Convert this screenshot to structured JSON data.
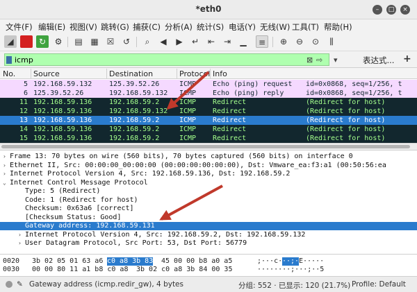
{
  "window": {
    "title": "*eth0",
    "min_icon": "minimize-icon",
    "max_icon": "maximize-icon",
    "close_icon": "close-icon"
  },
  "menu": [
    "文件(F)",
    "编辑(E)",
    "视图(V)",
    "跳转(G)",
    "捕获(C)",
    "分析(A)",
    "统计(S)",
    "电话(Y)",
    "无线(W)",
    "工具(T)",
    "帮助(H)"
  ],
  "filter": {
    "value": "icmp",
    "expression_label": "表达式...",
    "add_label": "+"
  },
  "packet_list": {
    "columns": [
      "No.",
      "Source",
      "Destination",
      "Protocol",
      "Info"
    ],
    "rows": [
      {
        "no": "5",
        "src": "192.168.59.132",
        "dst": "125.39.52.26",
        "proto": "ICMP",
        "info": "Echo (ping) request",
        "extra": "id=0x0868, seq=1/256, t",
        "style": "echo"
      },
      {
        "no": "6",
        "src": "125.39.52.26",
        "dst": "192.168.59.132",
        "proto": "ICMP",
        "info": "Echo (ping) reply",
        "extra": "id=0x0868, seq=1/256, t",
        "style": "echo"
      },
      {
        "no": "11",
        "src": "192.168.59.136",
        "dst": "192.168.59.2",
        "proto": "ICMP",
        "info": "Redirect",
        "extra": "(Redirect for host)",
        "style": "redir"
      },
      {
        "no": "12",
        "src": "192.168.59.136",
        "dst": "192.168.59.132",
        "proto": "ICMP",
        "info": "Redirect",
        "extra": "(Redirect for host)",
        "style": "redir"
      },
      {
        "no": "13",
        "src": "192.168.59.136",
        "dst": "192.168.59.2",
        "proto": "ICMP",
        "info": "Redirect",
        "extra": "(Redirect for host)",
        "style": "sel"
      },
      {
        "no": "14",
        "src": "192.168.59.136",
        "dst": "192.168.59.2",
        "proto": "ICMP",
        "info": "Redirect",
        "extra": "(Redirect for host)",
        "style": "redir"
      },
      {
        "no": "15",
        "src": "192.168.59.136",
        "dst": "192.168.59.2",
        "proto": "ICMP",
        "info": "Redirect",
        "extra": "(Redirect for host)",
        "style": "redir"
      }
    ]
  },
  "details": [
    {
      "arrow": "›",
      "indent": 0,
      "text": "Frame 13: 70 bytes on wire (560 bits), 70 bytes captured (560 bits) on interface 0"
    },
    {
      "arrow": "›",
      "indent": 0,
      "text": "Ethernet II, Src: 00:00:00_00:00:00 (00:00:00:00:00:00), Dst: Vmware_ea:f3:a1 (00:50:56:ea"
    },
    {
      "arrow": "›",
      "indent": 0,
      "text": "Internet Protocol Version 4, Src: 192.168.59.136, Dst: 192.168.59.2"
    },
    {
      "arrow": "⌄",
      "indent": 0,
      "text": "Internet Control Message Protocol"
    },
    {
      "arrow": "",
      "indent": 1,
      "text": "Type: 5 (Redirect)"
    },
    {
      "arrow": "",
      "indent": 1,
      "text": "Code: 1 (Redirect for host)"
    },
    {
      "arrow": "",
      "indent": 1,
      "text": "Checksum: 0x63a6 [correct]"
    },
    {
      "arrow": "",
      "indent": 1,
      "text": "[Checksum Status: Good]"
    },
    {
      "arrow": "",
      "indent": 1,
      "text": "Gateway address: 192.168.59.131",
      "selected": true
    },
    {
      "arrow": "›",
      "indent": 1,
      "text": "Internet Protocol Version 4, Src: 192.168.59.2, Dst: 192.168.59.132"
    },
    {
      "arrow": "›",
      "indent": 1,
      "text": "User Datagram Protocol, Src Port: 53, Dst Port: 56779"
    }
  ],
  "bytes": [
    {
      "offset": "0020",
      "pre": "3b 02 05 01 63 a6",
      "hl": "c0 a8  3b 83",
      "post": "45 00 00 b8 a0 a5",
      "ascii_pre": ";···c·",
      "ascii_hl": "··;·",
      "ascii_post": "E·····"
    },
    {
      "offset": "0030",
      "pre": "00 00 80 11 a1 b8 c0 a8",
      "hl": "",
      "post": "3b 02 c0 a8 3b 84 00 35",
      "ascii_pre": "········;···;··5",
      "ascii_hl": "",
      "ascii_post": ""
    }
  ],
  "status": {
    "text": "Gateway address (icmp.redir_gw), 4 bytes",
    "counts": "分组: 552 · 已显示: 120 (21.7%)",
    "profile": "Profile: Default"
  },
  "colors": {
    "echo_bg": "#f5d9ff",
    "redirect_bg": "#12272e",
    "redirect_fg": "#a4ff8c",
    "selection": "#2a7bcd",
    "filter_ok": "#afffaf",
    "annotation_arrow": "#c0392b"
  }
}
